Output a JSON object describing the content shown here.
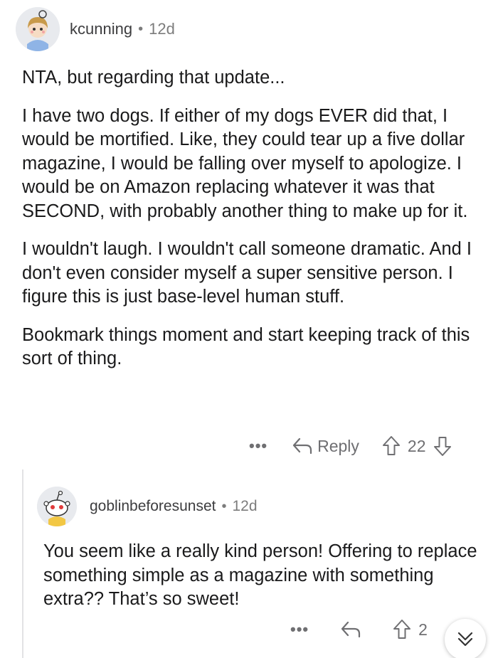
{
  "comment": {
    "username": "kcunning",
    "separator": "•",
    "age": "12d",
    "paragraphs": [
      "NTA, but regarding that update...",
      "I have two dogs. If either of my dogs EVER did that, I would be mortified. Like, they could tear up a five dollar magazine, I would be falling over myself to apologize. I would be on Amazon replacing whatever it was that SECOND, with probably another thing to make up for it.",
      "I wouldn't laugh. I wouldn't call someone dramatic. And I don't even consider myself a super sensitive person. I figure this is just base-level human stuff.",
      "Bookmark things moment and start keeping track of this sort of thing."
    ],
    "more_label": "•••",
    "reply_label": "Reply",
    "votes": "22"
  },
  "reply": {
    "username": "goblinbeforesunset",
    "separator": "•",
    "age": "12d",
    "paragraphs": [
      "You seem like a really kind person! Offering to replace something simple as a magazine with something extra?? That’s so sweet!"
    ],
    "more_label": "•••",
    "votes": "2"
  },
  "icons": {
    "reply": "reply-arrow-icon",
    "upvote": "upvote-arrow-icon",
    "downvote": "downvote-arrow-icon",
    "collapse": "chevron-double-down-icon"
  }
}
